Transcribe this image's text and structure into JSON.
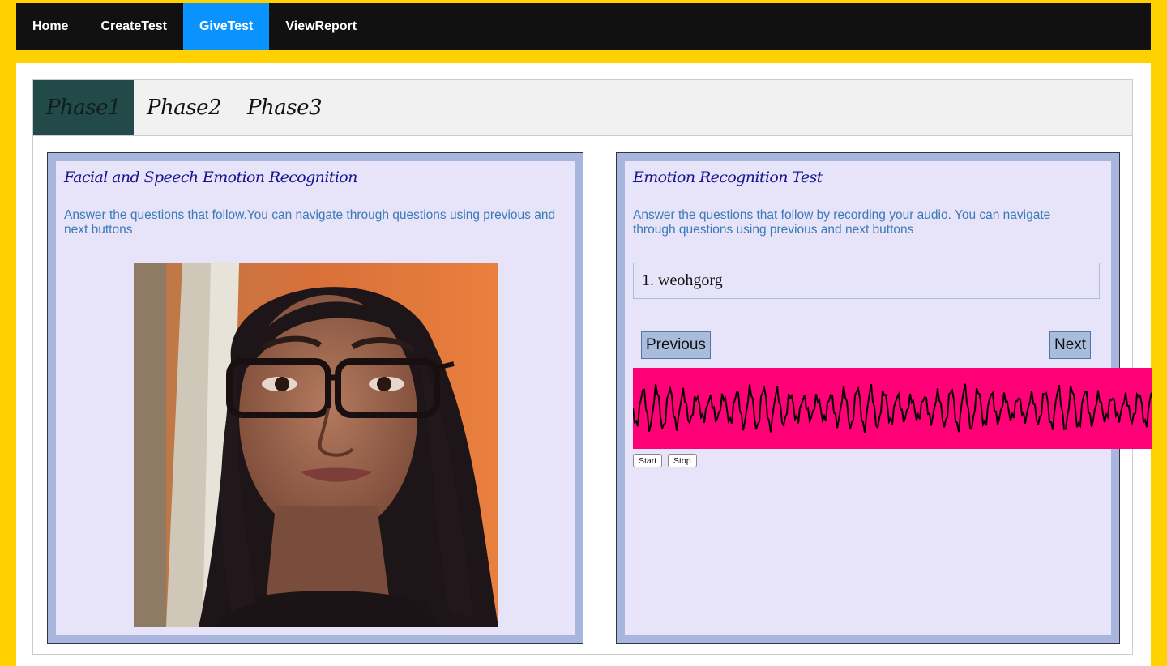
{
  "nav": {
    "items": [
      {
        "label": "Home"
      },
      {
        "label": "CreateTest"
      },
      {
        "label": "GiveTest"
      },
      {
        "label": "ViewReport"
      }
    ],
    "active": "GiveTest"
  },
  "tabs": [
    {
      "label": "Phase1"
    },
    {
      "label": "Phase2"
    },
    {
      "label": "Phase3"
    }
  ],
  "left_card": {
    "title": "Facial and Speech Emotion Recognition",
    "description": "Answer the questions that follow.You can navigate through questions using previous and next buttons"
  },
  "right_card": {
    "title": "Emotion Recognition Test",
    "description": "Answer the questions that follow by recording your audio. You can navigate through questions using previous and next buttons",
    "question": "1. weohgorg",
    "previous_label": "Previous",
    "next_label": "Next"
  },
  "recorder": {
    "start_label": "Start",
    "stop_label": "Stop",
    "waveform_color": "#ff0077"
  },
  "colors": {
    "page_bg": "#ffd100",
    "nav_bg": "#111111",
    "nav_active": "#0a93ff",
    "tab_active": "#224a48",
    "card_border_bg": "#a8b6dd",
    "card_inner_bg": "#e7e3f8",
    "title_color": "#1a1290",
    "desc_color": "#3a7ab8"
  }
}
